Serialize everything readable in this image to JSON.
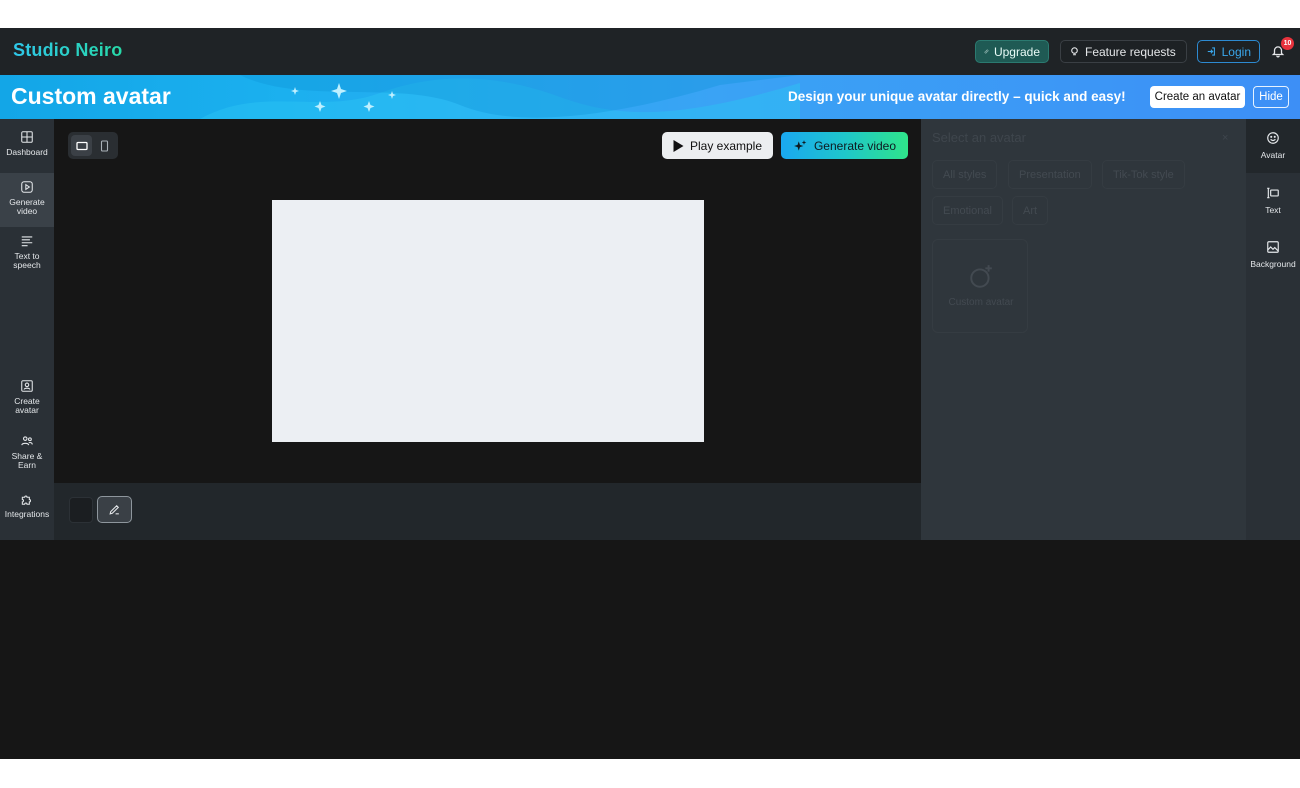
{
  "header": {
    "brand": "Studio Neiro",
    "upgrade_label": "Upgrade",
    "feature_requests_label": "Feature requests",
    "login_label": "Login",
    "notification_count": "10"
  },
  "banner": {
    "title": "Custom avatar",
    "subtitle": "Design your unique avatar directly – quick and easy!",
    "create_label": "Create an avatar",
    "hide_label": "Hide"
  },
  "sidebar": {
    "items": [
      {
        "label": "Dashboard",
        "icon": "grid-icon"
      },
      {
        "label": "Generate video",
        "icon": "play-square-icon"
      },
      {
        "label": "Text to speech",
        "icon": "text-lines-icon"
      },
      {
        "label": "Create avatar",
        "icon": "user-square-icon"
      },
      {
        "label": "Share & Earn",
        "icon": "users-icon"
      },
      {
        "label": "Integrations",
        "icon": "puzzle-icon"
      }
    ]
  },
  "toolbar": {
    "play_label": "Play example",
    "generate_label": "Generate video"
  },
  "panel": {
    "title": "Select an avatar",
    "close": "×",
    "filters": [
      "All styles",
      "Presentation",
      "Tik-Tok style",
      "Emotional",
      "Art"
    ],
    "card_label": "Custom avatar"
  },
  "rail": {
    "items": [
      {
        "label": "Avatar",
        "icon": "smile-icon"
      },
      {
        "label": "Text",
        "icon": "text-cursor-icon"
      },
      {
        "label": "Background",
        "icon": "image-icon"
      }
    ]
  },
  "colors": {
    "accent_teal": "#27d9a8",
    "accent_blue": "#1aa8f0",
    "banner_blue": "#1bb0ef",
    "badge_red": "#e8333d"
  }
}
